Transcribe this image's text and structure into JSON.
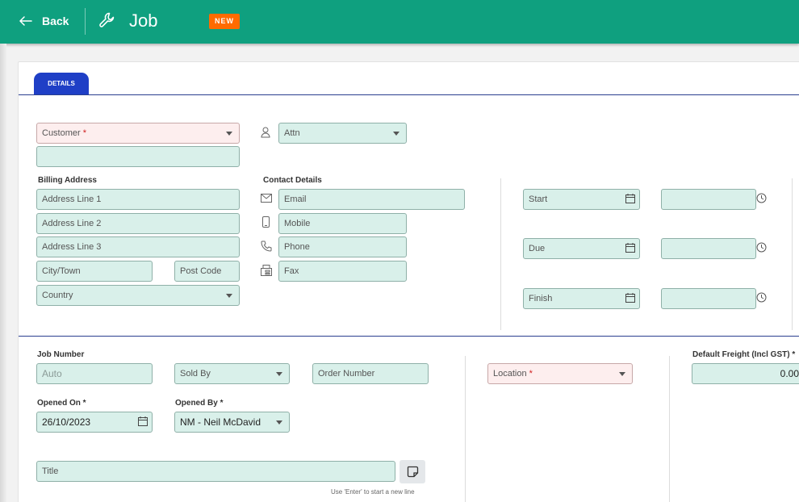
{
  "header": {
    "back_label": "Back",
    "title": "Job",
    "badge": "NEW"
  },
  "tabs": [
    {
      "label": "DETAILS"
    }
  ],
  "customer": {
    "label": "Customer",
    "required_mark": "*"
  },
  "attn": {
    "label": "Attn"
  },
  "billing": {
    "heading": "Billing Address",
    "line1": "Address Line 1",
    "line2": "Address Line 2",
    "line3": "Address Line 3",
    "city": "City/Town",
    "postcode": "Post Code",
    "country": "Country"
  },
  "contact": {
    "heading": "Contact Details",
    "email": "Email",
    "mobile": "Mobile",
    "phone": "Phone",
    "fax": "Fax"
  },
  "dates": {
    "start": "Start",
    "due": "Due",
    "finish": "Finish"
  },
  "job": {
    "job_number_label": "Job Number",
    "job_number_placeholder": "Auto",
    "sold_by": "Sold By",
    "order_number": "Order Number",
    "location": "Location",
    "location_required_mark": "*",
    "freight_label": "Default Freight (Incl GST) *",
    "freight_value": "0.00",
    "opened_on_label": "Opened On *",
    "opened_on_value": "26/10/2023",
    "opened_by_label": "Opened By *",
    "opened_by_value": "NM - Neil McDavid",
    "title_placeholder": "Title",
    "title_hint": "Use 'Enter' to start a new line"
  },
  "colors": {
    "header": "#0fa07f",
    "tab": "#1f3fc6",
    "badge": "#ff6b00",
    "field_bg": "#d9f0ea",
    "required_bg": "#fdeeee"
  },
  "icons": [
    "arrow-left-icon",
    "wrench-icon",
    "person-icon",
    "envelope-icon",
    "mobile-icon",
    "phone-icon",
    "fax-icon",
    "calendar-icon",
    "clock-icon",
    "note-icon",
    "chevron-down-icon"
  ]
}
